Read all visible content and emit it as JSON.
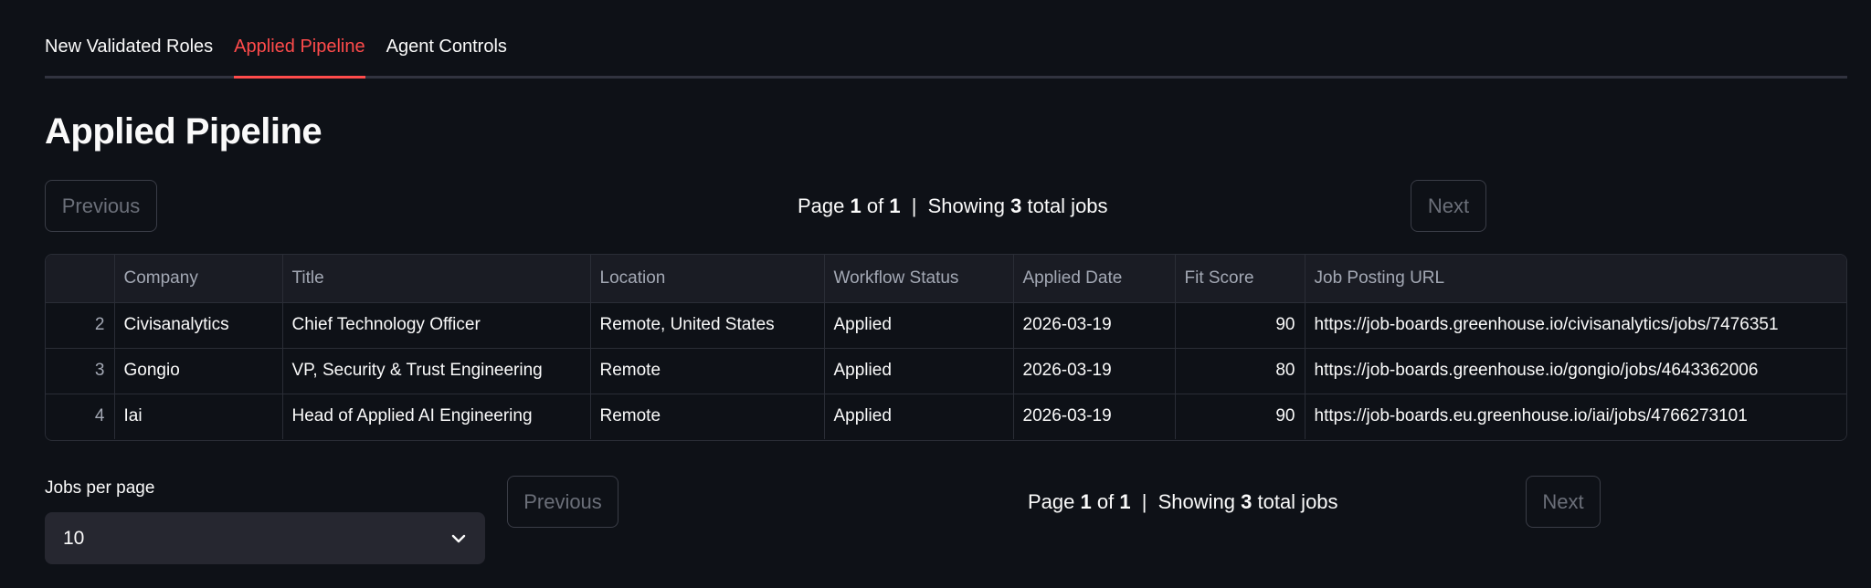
{
  "tabs": [
    {
      "label": "New Validated Roles",
      "active": false
    },
    {
      "label": "Applied Pipeline",
      "active": true
    },
    {
      "label": "Agent Controls",
      "active": false
    }
  ],
  "page_title": "Applied Pipeline",
  "pager": {
    "previous_label": "Previous",
    "next_label": "Next",
    "page_word": "Page",
    "current_page": "1",
    "of_word": "of",
    "total_pages": "1",
    "separator": "|",
    "showing_word": "Showing",
    "total_jobs": "3",
    "total_jobs_suffix": "total jobs"
  },
  "table": {
    "columns": [
      "",
      "Company",
      "Title",
      "Location",
      "Workflow Status",
      "Applied Date",
      "Fit Score",
      "Job Posting URL"
    ],
    "rows": [
      {
        "index": "2",
        "company": "Civisanalytics",
        "title": "Chief Technology Officer",
        "location": "Remote, United States",
        "status": "Applied",
        "applied_date": "2026-03-19",
        "fit_score": "90",
        "url": "https://job-boards.greenhouse.io/civisanalytics/jobs/7476351"
      },
      {
        "index": "3",
        "company": "Gongio",
        "title": "VP, Security & Trust Engineering",
        "location": "Remote",
        "status": "Applied",
        "applied_date": "2026-03-19",
        "fit_score": "80",
        "url": "https://job-boards.greenhouse.io/gongio/jobs/4643362006"
      },
      {
        "index": "4",
        "company": "Iai",
        "title": "Head of Applied AI Engineering",
        "location": "Remote",
        "status": "Applied",
        "applied_date": "2026-03-19",
        "fit_score": "90",
        "url": "https://job-boards.eu.greenhouse.io/iai/jobs/4766273101"
      }
    ]
  },
  "jobs_per_page": {
    "label": "Jobs per page",
    "value": "10",
    "icon": "chevron-down-icon"
  },
  "colors": {
    "background": "#0e1117",
    "accent": "#ff4b4b",
    "header_bg": "#1a1c24",
    "select_bg": "#262730"
  }
}
